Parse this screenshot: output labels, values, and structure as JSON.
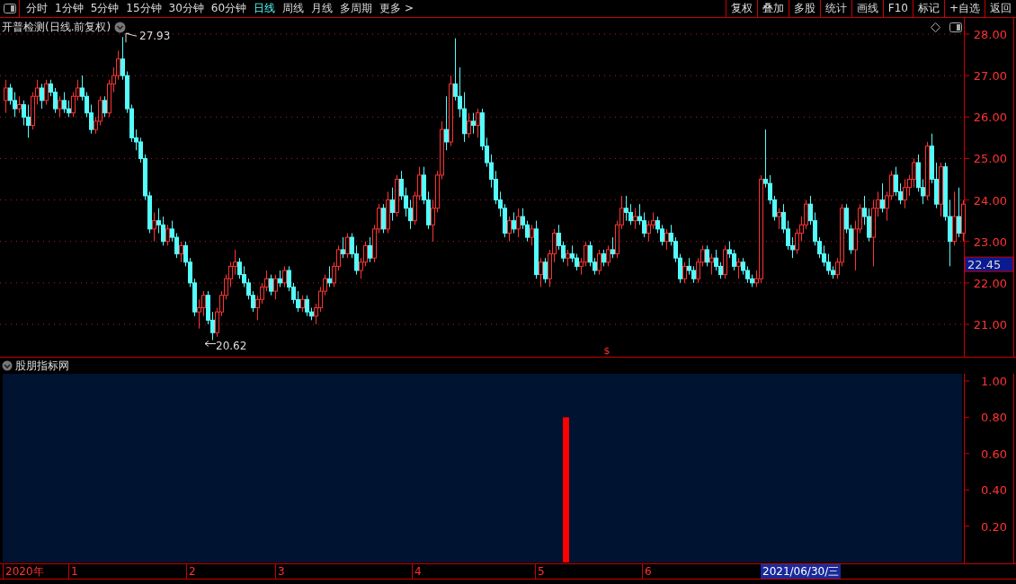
{
  "toolbar": {
    "periods": [
      {
        "label": "分时",
        "selected": false
      },
      {
        "label": "1分钟",
        "selected": false
      },
      {
        "label": "5分钟",
        "selected": false
      },
      {
        "label": "15分钟",
        "selected": false
      },
      {
        "label": "30分钟",
        "selected": false
      },
      {
        "label": "60分钟",
        "selected": false
      },
      {
        "label": "日线",
        "selected": true
      },
      {
        "label": "周线",
        "selected": false
      },
      {
        "label": "月线",
        "selected": false
      },
      {
        "label": "多周期",
        "selected": false
      },
      {
        "label": "更多 >",
        "selected": false
      }
    ],
    "actions": [
      "复权",
      "叠加",
      "多股",
      "统计",
      "画线",
      "F10",
      "标记",
      "+自选",
      "返回"
    ]
  },
  "price_chart": {
    "title": "开普检测(日线.前复权)",
    "high_label": "27.93",
    "low_label": "20.62",
    "current_price": "22.45",
    "marker": "$",
    "chart_data": {
      "type": "candlestick",
      "grid": true,
      "ylim": [
        20.22,
        28.39
      ],
      "yticks": [
        {
          "value": 28,
          "label": "28.00"
        },
        {
          "value": 27,
          "label": "27.00"
        },
        {
          "value": 26,
          "label": "26.00"
        },
        {
          "value": 25,
          "label": "25.00"
        },
        {
          "value": 24,
          "label": "24.00"
        },
        {
          "value": 23,
          "label": "23.00"
        },
        {
          "value": 22,
          "label": "22.00"
        },
        {
          "value": 21,
          "label": "21.00"
        }
      ],
      "ohlc": [
        [
          26.4,
          26.9,
          26.1,
          26.7
        ],
        [
          26.7,
          26.8,
          26.3,
          26.4
        ],
        [
          26.4,
          26.6,
          26.0,
          26.2
        ],
        [
          26.2,
          26.5,
          26.1,
          26.3
        ],
        [
          26.3,
          26.4,
          25.8,
          26.0
        ],
        [
          26.0,
          26.3,
          25.5,
          25.8
        ],
        [
          25.8,
          26.6,
          25.7,
          26.5
        ],
        [
          26.5,
          26.9,
          26.3,
          26.7
        ],
        [
          26.7,
          26.8,
          26.2,
          26.4
        ],
        [
          26.4,
          26.9,
          26.3,
          26.8
        ],
        [
          26.8,
          26.9,
          26.5,
          26.6
        ],
        [
          26.6,
          26.7,
          26.1,
          26.2
        ],
        [
          26.2,
          26.5,
          26.0,
          26.4
        ],
        [
          26.4,
          26.6,
          26.1,
          26.2
        ],
        [
          26.2,
          26.4,
          26.0,
          26.1
        ],
        [
          26.1,
          26.6,
          26.0,
          26.5
        ],
        [
          26.5,
          26.9,
          26.4,
          26.7
        ],
        [
          26.7,
          27.0,
          26.4,
          26.5
        ],
        [
          26.5,
          26.6,
          26.0,
          26.1
        ],
        [
          26.1,
          26.3,
          25.6,
          25.7
        ],
        [
          25.7,
          26.0,
          25.6,
          25.9
        ],
        [
          25.9,
          26.5,
          25.8,
          26.4
        ],
        [
          26.4,
          26.5,
          26.0,
          26.1
        ],
        [
          26.1,
          26.9,
          26.0,
          26.8
        ],
        [
          26.8,
          27.2,
          26.6,
          27.0
        ],
        [
          27.0,
          27.6,
          26.9,
          27.4
        ],
        [
          27.4,
          27.93,
          26.9,
          27.0
        ],
        [
          27.0,
          27.1,
          26.1,
          26.2
        ],
        [
          26.2,
          26.3,
          25.4,
          25.5
        ],
        [
          25.5,
          25.7,
          25.2,
          25.4
        ],
        [
          25.4,
          25.5,
          24.9,
          25.0
        ],
        [
          25.0,
          25.1,
          24.0,
          24.1
        ],
        [
          24.1,
          24.2,
          23.2,
          23.3
        ],
        [
          23.3,
          23.7,
          23.0,
          23.5
        ],
        [
          23.5,
          23.8,
          23.2,
          23.4
        ],
        [
          23.4,
          23.6,
          22.9,
          23.0
        ],
        [
          23.0,
          23.4,
          22.9,
          23.3
        ],
        [
          23.3,
          23.5,
          23.0,
          23.1
        ],
        [
          23.1,
          23.2,
          22.6,
          22.7
        ],
        [
          22.7,
          23.0,
          22.5,
          22.9
        ],
        [
          22.9,
          23.0,
          22.4,
          22.5
        ],
        [
          22.5,
          22.6,
          21.9,
          22.0
        ],
        [
          22.0,
          22.1,
          21.2,
          21.3
        ],
        [
          21.3,
          21.6,
          20.9,
          21.4
        ],
        [
          21.4,
          21.8,
          21.2,
          21.7
        ],
        [
          21.7,
          21.8,
          21.0,
          21.1
        ],
        [
          21.1,
          21.3,
          20.62,
          20.8
        ],
        [
          20.8,
          21.4,
          20.7,
          21.3
        ],
        [
          21.3,
          21.8,
          21.2,
          21.7
        ],
        [
          21.7,
          22.2,
          21.6,
          22.1
        ],
        [
          22.1,
          22.5,
          21.9,
          22.4
        ],
        [
          22.4,
          22.8,
          22.2,
          22.5
        ],
        [
          22.5,
          22.6,
          22.1,
          22.2
        ],
        [
          22.2,
          22.4,
          21.9,
          22.0
        ],
        [
          22.0,
          22.1,
          21.6,
          21.7
        ],
        [
          21.7,
          21.8,
          21.3,
          21.4
        ],
        [
          21.4,
          21.7,
          21.1,
          21.6
        ],
        [
          21.6,
          22.0,
          21.5,
          21.9
        ],
        [
          21.9,
          22.3,
          21.8,
          22.1
        ],
        [
          22.1,
          22.2,
          21.7,
          21.8
        ],
        [
          21.8,
          22.2,
          21.6,
          22.1
        ],
        [
          22.1,
          22.3,
          21.9,
          22.0
        ],
        [
          22.0,
          22.4,
          21.9,
          22.3
        ],
        [
          22.3,
          22.4,
          21.8,
          21.9
        ],
        [
          21.9,
          22.0,
          21.5,
          21.6
        ],
        [
          21.6,
          21.8,
          21.3,
          21.4
        ],
        [
          21.4,
          21.7,
          21.3,
          21.6
        ],
        [
          21.6,
          21.7,
          21.2,
          21.3
        ],
        [
          21.3,
          21.4,
          21.1,
          21.2
        ],
        [
          21.2,
          21.5,
          21.0,
          21.4
        ],
        [
          21.4,
          21.9,
          21.3,
          21.8
        ],
        [
          21.8,
          22.2,
          21.7,
          22.1
        ],
        [
          22.1,
          22.4,
          21.9,
          22.0
        ],
        [
          22.0,
          22.5,
          21.9,
          22.4
        ],
        [
          22.4,
          22.9,
          22.3,
          22.8
        ],
        [
          22.8,
          23.1,
          22.6,
          22.7
        ],
        [
          22.7,
          23.2,
          22.6,
          23.1
        ],
        [
          23.1,
          23.2,
          22.6,
          22.7
        ],
        [
          22.7,
          22.9,
          22.2,
          22.3
        ],
        [
          22.3,
          22.6,
          22.1,
          22.5
        ],
        [
          22.5,
          23.0,
          22.4,
          22.9
        ],
        [
          22.9,
          23.1,
          22.5,
          22.6
        ],
        [
          22.6,
          23.4,
          22.5,
          23.3
        ],
        [
          23.3,
          23.9,
          23.2,
          23.8
        ],
        [
          23.8,
          23.9,
          23.2,
          23.3
        ],
        [
          23.3,
          24.2,
          23.2,
          24.0
        ],
        [
          24.0,
          24.3,
          23.5,
          23.7
        ],
        [
          23.7,
          24.6,
          23.6,
          24.5
        ],
        [
          24.5,
          24.7,
          24.0,
          24.1
        ],
        [
          24.1,
          24.3,
          23.6,
          23.8
        ],
        [
          23.8,
          24.0,
          23.3,
          23.5
        ],
        [
          23.5,
          24.2,
          23.4,
          24.1
        ],
        [
          24.1,
          24.8,
          24.0,
          24.6
        ],
        [
          24.6,
          24.8,
          23.9,
          24.0
        ],
        [
          24.0,
          24.2,
          23.3,
          23.4
        ],
        [
          23.4,
          24.0,
          23.0,
          23.8
        ],
        [
          23.8,
          24.7,
          23.7,
          24.6
        ],
        [
          24.6,
          25.9,
          24.5,
          25.7
        ],
        [
          25.7,
          26.5,
          25.2,
          25.4
        ],
        [
          25.4,
          27.0,
          25.3,
          26.8
        ],
        [
          26.8,
          27.9,
          26.4,
          26.5
        ],
        [
          26.5,
          27.2,
          26.0,
          26.2
        ],
        [
          26.2,
          26.6,
          25.4,
          25.6
        ],
        [
          25.6,
          26.1,
          25.5,
          25.9
        ],
        [
          25.9,
          26.1,
          25.6,
          25.8
        ],
        [
          25.8,
          26.2,
          25.5,
          26.1
        ],
        [
          26.1,
          26.2,
          25.2,
          25.3
        ],
        [
          25.3,
          25.5,
          24.8,
          24.9
        ],
        [
          24.9,
          25.1,
          24.3,
          24.5
        ],
        [
          24.5,
          24.7,
          23.9,
          24.0
        ],
        [
          24.0,
          24.2,
          23.6,
          23.8
        ],
        [
          23.8,
          23.9,
          23.1,
          23.2
        ],
        [
          23.2,
          23.6,
          23.0,
          23.5
        ],
        [
          23.5,
          23.7,
          23.2,
          23.3
        ],
        [
          23.3,
          23.8,
          23.1,
          23.6
        ],
        [
          23.6,
          23.8,
          23.3,
          23.4
        ],
        [
          23.4,
          23.5,
          23.0,
          23.1
        ],
        [
          23.1,
          23.4,
          22.9,
          23.3
        ],
        [
          23.3,
          23.5,
          22.1,
          22.2
        ],
        [
          22.2,
          22.6,
          21.9,
          22.5
        ],
        [
          22.5,
          22.6,
          22.0,
          22.1
        ],
        [
          22.1,
          22.8,
          21.9,
          22.7
        ],
        [
          22.7,
          23.3,
          22.5,
          23.2
        ],
        [
          23.2,
          23.4,
          22.8,
          22.9
        ],
        [
          22.9,
          23.0,
          22.5,
          22.6
        ],
        [
          22.6,
          22.8,
          22.4,
          22.7
        ],
        [
          22.7,
          22.9,
          22.5,
          22.6
        ],
        [
          22.6,
          22.7,
          22.3,
          22.4
        ],
        [
          22.4,
          22.6,
          22.2,
          22.5
        ],
        [
          22.5,
          23.0,
          22.4,
          22.9
        ],
        [
          22.9,
          23.0,
          22.4,
          22.5
        ],
        [
          22.5,
          22.6,
          22.2,
          22.3
        ],
        [
          22.3,
          22.8,
          22.2,
          22.7
        ],
        [
          22.7,
          22.8,
          22.4,
          22.5
        ],
        [
          22.5,
          22.9,
          22.4,
          22.8
        ],
        [
          22.8,
          23.1,
          22.6,
          22.7
        ],
        [
          22.7,
          23.5,
          22.6,
          23.4
        ],
        [
          23.4,
          24.1,
          23.3,
          23.8
        ],
        [
          23.8,
          24.1,
          23.5,
          23.7
        ],
        [
          23.7,
          23.9,
          23.4,
          23.5
        ],
        [
          23.5,
          23.8,
          23.3,
          23.6
        ],
        [
          23.6,
          23.9,
          23.4,
          23.5
        ],
        [
          23.5,
          23.7,
          23.1,
          23.2
        ],
        [
          23.2,
          23.5,
          23.0,
          23.4
        ],
        [
          23.4,
          23.7,
          23.3,
          23.5
        ],
        [
          23.5,
          23.6,
          23.2,
          23.3
        ],
        [
          23.3,
          23.4,
          22.9,
          23.0
        ],
        [
          23.0,
          23.3,
          22.8,
          23.2
        ],
        [
          23.2,
          23.4,
          22.9,
          23.0
        ],
        [
          23.0,
          23.1,
          22.5,
          22.6
        ],
        [
          22.6,
          22.7,
          22.0,
          22.1
        ],
        [
          22.1,
          22.5,
          22.0,
          22.4
        ],
        [
          22.4,
          22.6,
          22.2,
          22.3
        ],
        [
          22.3,
          22.4,
          22.0,
          22.1
        ],
        [
          22.1,
          22.6,
          22.0,
          22.5
        ],
        [
          22.5,
          22.9,
          22.4,
          22.8
        ],
        [
          22.8,
          22.9,
          22.4,
          22.5
        ],
        [
          22.5,
          22.7,
          22.2,
          22.6
        ],
        [
          22.6,
          22.8,
          22.3,
          22.4
        ],
        [
          22.4,
          22.5,
          22.1,
          22.2
        ],
        [
          22.2,
          22.9,
          22.1,
          22.8
        ],
        [
          22.8,
          23.0,
          22.6,
          22.7
        ],
        [
          22.7,
          22.8,
          22.3,
          22.4
        ],
        [
          22.4,
          22.6,
          22.1,
          22.5
        ],
        [
          22.5,
          22.6,
          22.2,
          22.3
        ],
        [
          22.3,
          22.4,
          22.0,
          22.1
        ],
        [
          22.1,
          22.2,
          21.9,
          22.0
        ],
        [
          22.0,
          22.3,
          21.9,
          22.1
        ],
        [
          22.1,
          24.6,
          22.0,
          24.5
        ],
        [
          24.5,
          25.7,
          24.3,
          24.4
        ],
        [
          24.4,
          24.6,
          23.9,
          24.0
        ],
        [
          24.0,
          24.1,
          23.5,
          23.6
        ],
        [
          23.6,
          23.8,
          23.3,
          23.7
        ],
        [
          23.7,
          23.9,
          23.2,
          23.3
        ],
        [
          23.3,
          23.5,
          22.8,
          22.9
        ],
        [
          22.9,
          23.1,
          22.6,
          22.8
        ],
        [
          22.8,
          23.3,
          22.7,
          23.2
        ],
        [
          23.2,
          23.6,
          23.0,
          23.4
        ],
        [
          23.4,
          24.0,
          23.3,
          23.9
        ],
        [
          23.9,
          24.1,
          23.4,
          23.5
        ],
        [
          23.5,
          23.7,
          22.9,
          23.0
        ],
        [
          23.0,
          23.1,
          22.6,
          22.7
        ],
        [
          22.7,
          22.9,
          22.4,
          22.5
        ],
        [
          22.5,
          22.7,
          22.2,
          22.3
        ],
        [
          22.3,
          22.4,
          22.1,
          22.2
        ],
        [
          22.2,
          22.6,
          22.1,
          22.5
        ],
        [
          22.5,
          23.9,
          22.4,
          23.8
        ],
        [
          23.8,
          23.9,
          23.2,
          23.3
        ],
        [
          23.3,
          23.4,
          22.7,
          22.8
        ],
        [
          22.8,
          23.5,
          22.3,
          23.3
        ],
        [
          23.3,
          23.9,
          23.2,
          23.8
        ],
        [
          23.8,
          24.1,
          23.4,
          23.6
        ],
        [
          23.6,
          23.8,
          23.0,
          23.1
        ],
        [
          23.1,
          24.0,
          22.4,
          23.8
        ],
        [
          23.8,
          24.2,
          23.6,
          24.0
        ],
        [
          24.0,
          24.4,
          23.7,
          23.8
        ],
        [
          23.8,
          24.2,
          23.5,
          24.1
        ],
        [
          24.1,
          24.7,
          24.0,
          24.6
        ],
        [
          24.6,
          24.8,
          24.1,
          24.2
        ],
        [
          24.2,
          24.4,
          23.9,
          24.0
        ],
        [
          24.0,
          24.5,
          23.8,
          24.3
        ],
        [
          24.3,
          24.6,
          24.1,
          24.5
        ],
        [
          24.5,
          25.0,
          24.3,
          24.9
        ],
        [
          24.9,
          25.1,
          24.2,
          24.3
        ],
        [
          24.3,
          24.5,
          23.9,
          24.1
        ],
        [
          24.1,
          25.4,
          24.0,
          25.3
        ],
        [
          25.3,
          25.6,
          24.4,
          24.5
        ],
        [
          24.5,
          24.9,
          23.8,
          23.9
        ],
        [
          23.9,
          24.9,
          23.6,
          24.8
        ],
        [
          24.8,
          24.9,
          23.5,
          23.6
        ],
        [
          23.6,
          24.0,
          22.4,
          23.0
        ],
        [
          23.0,
          24.2,
          22.9,
          23.6
        ],
        [
          23.6,
          24.3,
          23.1,
          23.2
        ],
        [
          23.2,
          24.0,
          23.0,
          23.9
        ]
      ]
    }
  },
  "indicator": {
    "title": "股朋指标网",
    "tick_labels": [
      "1.00",
      "0.80",
      "0.60",
      "0.40",
      "0.20"
    ],
    "signal_bar": {
      "level": 0.8
    }
  },
  "time_axis": {
    "labels": [
      "2020年",
      "1",
      "2",
      "3",
      "4",
      "5",
      "6"
    ],
    "cursor_date": "2021/06/30/三"
  }
}
